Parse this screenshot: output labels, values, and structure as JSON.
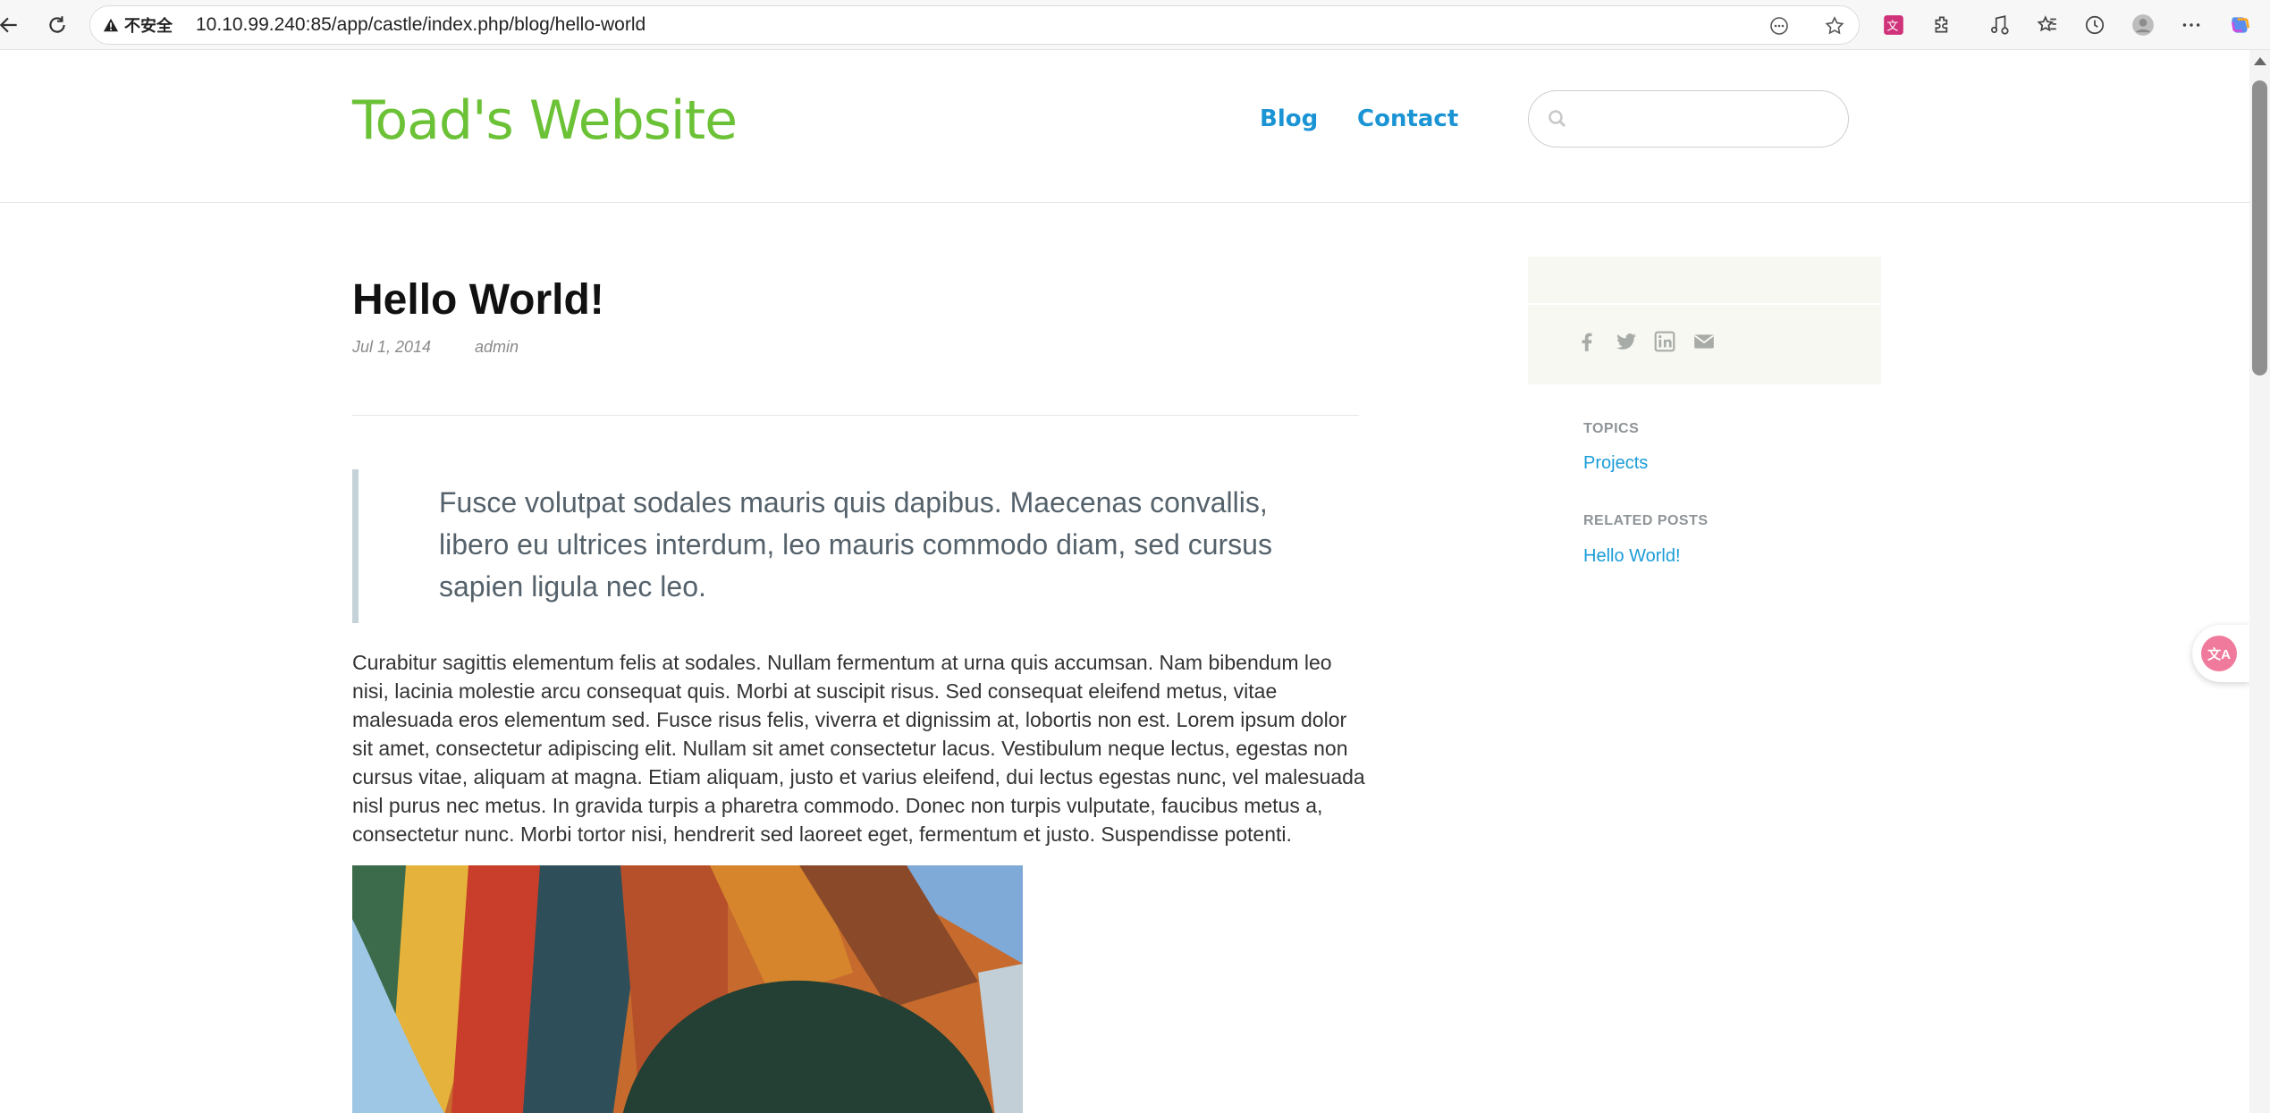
{
  "browser": {
    "security_label": "不安全",
    "url": "10.10.99.240:85/app/castle/index.php/blog/hello-world"
  },
  "site": {
    "title": "Toad's Website",
    "nav": [
      {
        "label": "Blog"
      },
      {
        "label": "Contact"
      }
    ],
    "search": {
      "placeholder": "",
      "value": ""
    }
  },
  "post": {
    "title": "Hello World!",
    "date": "Jul 1, 2014",
    "author": "admin",
    "quote": "Fusce volutpat sodales mauris quis dapibus. Maecenas convallis, libero eu ultrices interdum, leo mauris commodo diam, sed cursus sapien ligula nec leo.",
    "body": "Curabitur sagittis elementum felis at sodales. Nullam fermentum at urna quis accumsan. Nam bibendum leo nisi, lacinia molestie arcu consequat quis. Morbi at suscipit risus. Sed consequat eleifend metus, vitae malesuada eros elementum sed. Fusce risus felis, viverra et dignissim at, lobortis non est. Lorem ipsum dolor sit amet, consectetur adipiscing elit. Nullam sit amet consectetur lacus. Vestibulum neque lectus, egestas non cursus vitae, aliquam at magna. Etiam aliquam, justo et varius eleifend, dui lectus egestas nunc, vel malesuada nisl purus nec metus. In gravida turpis a pharetra commodo. Donec non turpis vulputate, faucibus metus a, consectetur nunc. Morbi tortor nisi, hendrerit sed laoreet eget, fermentum et justo. Suspendisse potenti."
  },
  "sidebar": {
    "share_icons": [
      "facebook-icon",
      "twitter-icon",
      "linkedin-icon",
      "email-icon"
    ],
    "topics_heading": "TOPICS",
    "topics": [
      {
        "label": "Projects"
      }
    ],
    "related_heading": "RELATED POSTS",
    "related": [
      {
        "label": "Hello World!"
      }
    ]
  },
  "colors": {
    "site_title": "#6cc236",
    "link": "#1a94d4",
    "quote_border": "#c5d3d8"
  }
}
